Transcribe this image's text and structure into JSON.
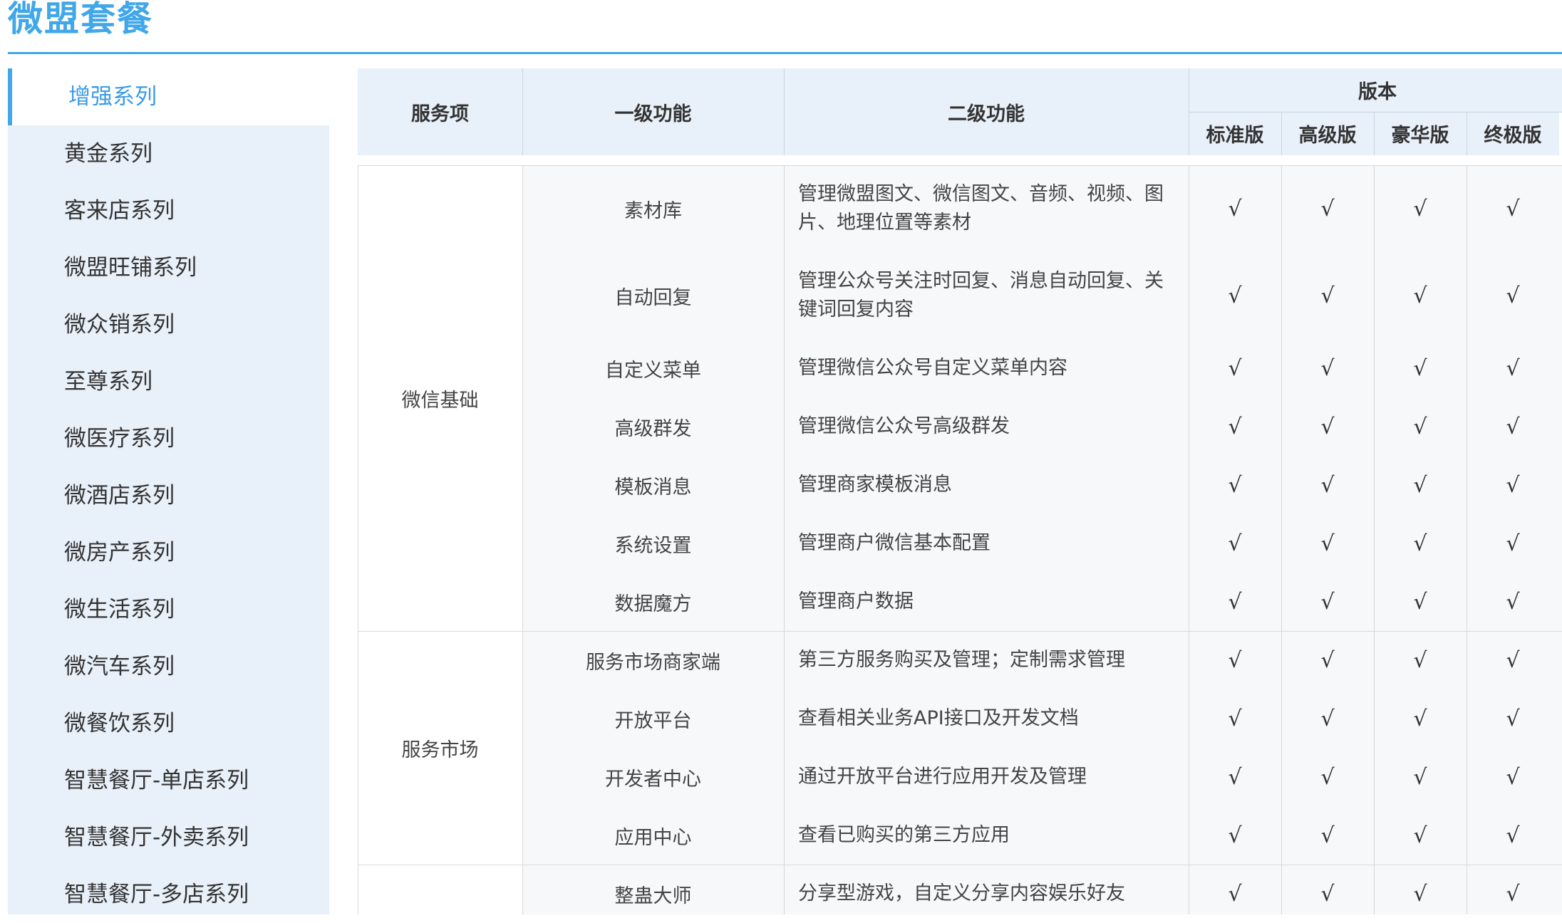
{
  "page": {
    "title": "微盟套餐"
  },
  "sidebar": {
    "items": [
      {
        "label": "增强系列",
        "active": true
      },
      {
        "label": "黄金系列"
      },
      {
        "label": "客来店系列"
      },
      {
        "label": "微盟旺铺系列"
      },
      {
        "label": "微众销系列"
      },
      {
        "label": "至尊系列"
      },
      {
        "label": "微医疗系列"
      },
      {
        "label": "微酒店系列"
      },
      {
        "label": "微房产系列"
      },
      {
        "label": "微生活系列"
      },
      {
        "label": "微汽车系列"
      },
      {
        "label": "微餐饮系列"
      },
      {
        "label": "智慧餐厅-单店系列"
      },
      {
        "label": "智慧餐厅-外卖系列"
      },
      {
        "label": "智慧餐厅-多店系列"
      }
    ]
  },
  "table": {
    "headers": {
      "service": "服务项",
      "level1": "一级功能",
      "level2": "二级功能",
      "version": "版本",
      "versions": [
        "标准版",
        "高级版",
        "豪华版",
        "终极版"
      ]
    },
    "groups": [
      {
        "service": "微信基础",
        "rows": [
          {
            "level1": "素材库",
            "level2": "管理微盟图文、微信图文、音频、视频、图片、地理位置等素材",
            "checks": [
              "√",
              "√",
              "√",
              "√"
            ]
          },
          {
            "level1": "自动回复",
            "level2": "管理公众号关注时回复、消息自动回复、关键词回复内容",
            "checks": [
              "√",
              "√",
              "√",
              "√"
            ]
          },
          {
            "level1": "自定义菜单",
            "level2": "管理微信公众号自定义菜单内容",
            "checks": [
              "√",
              "√",
              "√",
              "√"
            ]
          },
          {
            "level1": "高级群发",
            "level2": "管理微信公众号高级群发",
            "checks": [
              "√",
              "√",
              "√",
              "√"
            ]
          },
          {
            "level1": "模板消息",
            "level2": "管理商家模板消息",
            "checks": [
              "√",
              "√",
              "√",
              "√"
            ]
          },
          {
            "level1": "系统设置",
            "level2": "管理商户微信基本配置",
            "checks": [
              "√",
              "√",
              "√",
              "√"
            ]
          },
          {
            "level1": "数据魔方",
            "level2": "管理商户数据",
            "checks": [
              "√",
              "√",
              "√",
              "√"
            ]
          }
        ]
      },
      {
        "service": "服务市场",
        "rows": [
          {
            "level1": "服务市场商家端",
            "level2": "第三方服务购买及管理；定制需求管理",
            "checks": [
              "√",
              "√",
              "√",
              "√"
            ]
          },
          {
            "level1": "开放平台",
            "level2": "查看相关业务API接口及开发文档",
            "checks": [
              "√",
              "√",
              "√",
              "√"
            ]
          },
          {
            "level1": "开发者中心",
            "level2": "通过开放平台进行应用开发及管理",
            "checks": [
              "√",
              "√",
              "√",
              "√"
            ]
          },
          {
            "level1": "应用中心",
            "level2": "查看已购买的第三方应用",
            "checks": [
              "√",
              "√",
              "√",
              "√"
            ]
          }
        ]
      },
      {
        "service": "",
        "rows": [
          {
            "level1": "整蛊大师",
            "level2": "分享型游戏，自定义分享内容娱乐好友",
            "checks": [
              "√",
              "√",
              "√",
              "√"
            ]
          }
        ]
      }
    ]
  }
}
